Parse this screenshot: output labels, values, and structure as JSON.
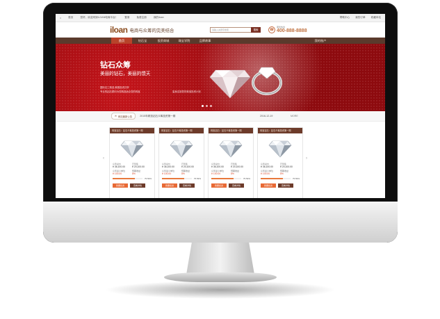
{
  "topbar": {
    "left_items": [
      "首页",
      "您好，欢迎来到ILOAN电商平台！",
      "登录",
      "免费注册",
      "我的iloan"
    ],
    "right_items": [
      "帮助中心",
      "我的订单",
      "收藏本站"
    ]
  },
  "header": {
    "logo": "iloan",
    "slogan": "电商与众筹的完美结合",
    "search_placeholder": "请输入关键字搜索",
    "search_button": "搜索",
    "phone_label": "服务热线",
    "phone_number": "400-888-8888"
  },
  "nav": {
    "items": [
      "首页",
      "钻石宝",
      "投资商城",
      "珠宝学院",
      "品牌故事"
    ],
    "account": "我的账户"
  },
  "banner": {
    "title": "钻石众筹",
    "subtitle": "美丽的钻石，美丽的馈天",
    "line1": "国际名工精选    美丽投资共享",
    "line2": "专业的钻石顾问为您精选适合您的珠宝",
    "line3": "量身定制您的珠宝投资计划",
    "active_slide": 1,
    "slide_count": 3
  },
  "announcement": {
    "tag": "网站最新公告",
    "text": "2015年精选钻石众筹投资第一期",
    "date": "2016-12-19",
    "more": "MORE"
  },
  "products": [
    {
      "title": "珠宝钻石：钻石众筹投资第一期",
      "price_label": "众筹总价",
      "price": "¥ 36,100.00",
      "raised_label": "已筹集",
      "raised": "¥ 20,100.00",
      "unit_label": "众筹最小单位",
      "unit": "¥ 100.00",
      "profit_label": "预期收益",
      "profit": "8%",
      "progress": 75.59,
      "progress_text": "75.59%",
      "invest": "我要投资",
      "detail": "查看详情"
    },
    {
      "title": "珠宝钻石：钻石众筹投资第一期",
      "price_label": "众筹总价",
      "price": "¥ 36,100.00",
      "raised_label": "已筹集",
      "raised": "¥ 20,100.00",
      "unit_label": "众筹最小单位",
      "unit": "¥ 100.00",
      "profit_label": "预期收益",
      "profit": "8%",
      "progress": 75.59,
      "progress_text": "75.59%",
      "invest": "我要投资",
      "detail": "查看详情"
    },
    {
      "title": "珠宝钻石：钻石众筹投资第一期",
      "price_label": "众筹总价",
      "price": "¥ 36,100.00",
      "raised_label": "已筹集",
      "raised": "¥ 20,100.00",
      "unit_label": "众筹最小单位",
      "unit": "¥ 100.00",
      "profit_label": "预期收益",
      "profit": "8%",
      "progress": 75.59,
      "progress_text": "75.59%",
      "invest": "我要投资",
      "detail": "查看详情"
    },
    {
      "title": "珠宝钻石：钻石众筹投资第一期",
      "price_label": "众筹总价",
      "price": "¥ 36,100.00",
      "raised_label": "已筹集",
      "raised": "¥ 20,100.00",
      "unit_label": "众筹最小单位",
      "unit": "¥ 100.00",
      "profit_label": "预期收益",
      "profit": "8%",
      "progress": 75.59,
      "progress_text": "75.59%",
      "invest": "我要投资",
      "detail": "查看详情"
    }
  ],
  "colors": {
    "brand_brown": "#6d3b2a",
    "accent_orange": "#e86a35",
    "banner_red": "#a10d12"
  }
}
